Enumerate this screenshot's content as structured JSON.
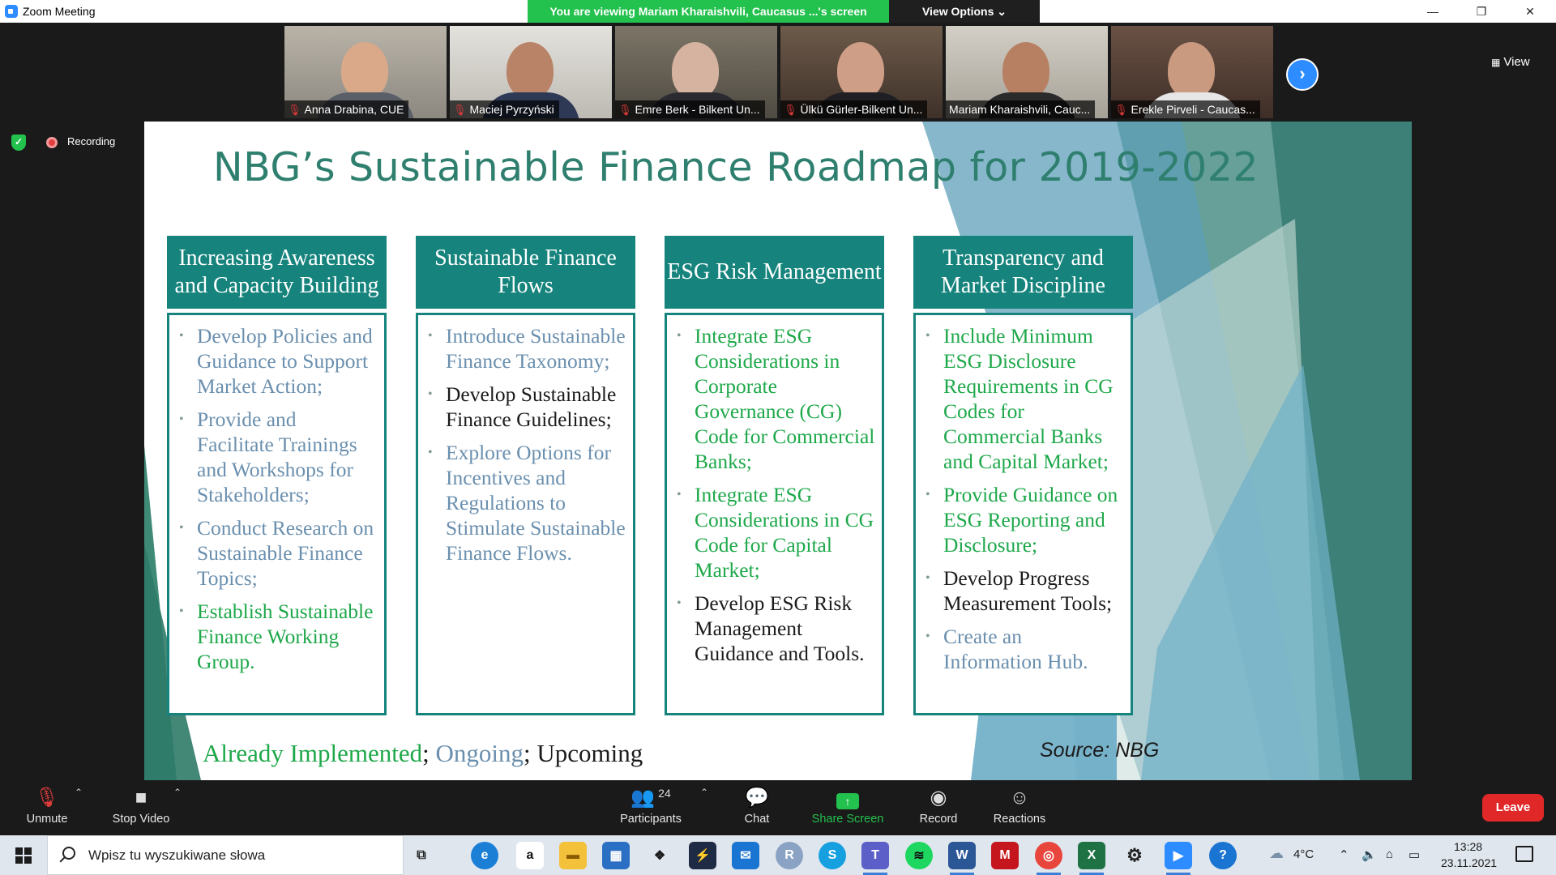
{
  "window": {
    "title": "Zoom Meeting",
    "minimize": "—",
    "restore": "❐",
    "close": "✕"
  },
  "share_banner": "You are viewing Mariam  Kharaishvili, Caucasus ...'s screen",
  "view_options": "View Options ⌄",
  "gallery": {
    "participants": [
      {
        "name": "Anna Drabina, CUE",
        "muted": true
      },
      {
        "name": "Maciej Pyrzyński",
        "muted": true
      },
      {
        "name": "Emre Berk - Bilkent Un...",
        "muted": true
      },
      {
        "name": "Ülkü Gürler-Bilkent Un...",
        "muted": true
      },
      {
        "name": "Mariam Kharaishvili, Cauc...",
        "muted": false,
        "active": true
      },
      {
        "name": "Erekle Pirveli - Caucas...",
        "muted": true
      }
    ],
    "next_icon": "chevron-right-icon",
    "view_label": "View"
  },
  "status": {
    "recording_label": "Recording"
  },
  "slide": {
    "title": "NBG’s Sustainable Finance Roadmap for 2019-2022",
    "columns": [
      {
        "heading": "Increasing Awareness and Capacity Building",
        "items": [
          {
            "text": "Develop Policies and Guidance to Support Market Action;",
            "status": "ongoing"
          },
          {
            "text": "Provide and Facilitate Trainings and Workshops for Stakeholders;",
            "status": "ongoing"
          },
          {
            "text": "Conduct Research on Sustainable Finance Topics;",
            "status": "ongoing"
          },
          {
            "text": "Establish Sustainable Finance Working Group.",
            "status": "done"
          }
        ]
      },
      {
        "heading": "Sustainable Finance Flows",
        "items": [
          {
            "text": "Introduce Sustainable Finance Taxonomy;",
            "status": "ongoing"
          },
          {
            "text": "Develop Sustainable Finance Guidelines;",
            "status": "upcoming"
          },
          {
            "text": "Explore Options for Incentives and Regulations to Stimulate Sustainable Finance Flows.",
            "status": "ongoing"
          }
        ]
      },
      {
        "heading": "ESG Risk Management",
        "items": [
          {
            "text": "Integrate ESG Considerations in Corporate Governance (CG) Code for Commercial Banks;",
            "status": "done"
          },
          {
            "text": "Integrate ESG Considerations in CG Code for Capital Market;",
            "status": "done"
          },
          {
            "text": "Develop ESG Risk Management Guidance and Tools.",
            "status": "upcoming"
          }
        ]
      },
      {
        "heading": "Transparency and Market Discipline",
        "items": [
          {
            "text": "Include Minimum ESG Disclosure Requirements in CG Codes for Commercial Banks and Capital Market;",
            "status": "done"
          },
          {
            "text": "Provide Guidance on ESG Reporting and Disclosure;",
            "status": "done"
          },
          {
            "text": "Develop Progress Measurement Tools;",
            "status": "upcoming"
          },
          {
            "text": "Create an Information Hub.",
            "status": "ongoing"
          }
        ]
      }
    ],
    "legend": {
      "implemented": "Already Implemented",
      "sep1": "; ",
      "ongoing": "Ongoing",
      "sep2": "; ",
      "upcoming": "Upcoming"
    },
    "source": "Source: NBG",
    "colors": {
      "done": "#1ea84a",
      "ongoing": "#6a8fae",
      "upcoming": "#1b1b1b",
      "header": "#16847d",
      "title": "#2f7f6f"
    }
  },
  "controls": {
    "unmute": "Unmute",
    "stop_video": "Stop Video",
    "participants": "Participants",
    "participants_count": "24",
    "chat": "Chat",
    "share_screen": "Share Screen",
    "record": "Record",
    "reactions": "Reactions",
    "leave": "Leave"
  },
  "taskbar": {
    "search_placeholder": "Wpisz tu wyszukiwane słowa",
    "apps": [
      "task-view-icon",
      "edge-icon",
      "amazon-icon",
      "file-explorer-icon",
      "store-icon",
      "dropbox-icon",
      "powershell-icon",
      "mail-icon",
      "r-icon",
      "skype-icon",
      "teams-icon",
      "spotify-icon",
      "word-icon",
      "mendeley-icon",
      "chrome-icon",
      "excel-icon",
      "settings-icon",
      "zoom-icon"
    ],
    "help_icon": "help-icon",
    "temperature": "4°C",
    "time": "13:28",
    "date": "23.11.2021"
  }
}
